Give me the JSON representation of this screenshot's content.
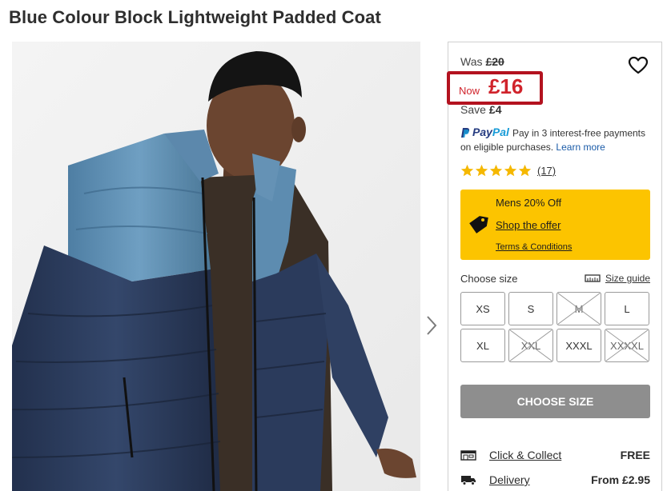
{
  "product": {
    "title": "Blue Colour Block Lightweight Padded Coat",
    "image_description": "model wearing blue colour block padded coat"
  },
  "pricing": {
    "was_label": "Was",
    "was_price": "£20",
    "now_label": "Now",
    "now_price": "£16",
    "save_label": "Save",
    "save_amount": "£4"
  },
  "paypal": {
    "pay": "Pay",
    "pal": "Pal",
    "message": "Pay in 3 interest-free payments on eligible purchases.",
    "link": "Learn more"
  },
  "rating": {
    "stars": 5,
    "review_count": "(17)"
  },
  "offer": {
    "title": "Mens 20% Off",
    "link": "Shop the offer",
    "terms": "Terms & Conditions",
    "color": "#fcc400"
  },
  "size": {
    "label": "Choose size",
    "guide": "Size guide",
    "options": [
      {
        "label": "XS",
        "available": true
      },
      {
        "label": "S",
        "available": true
      },
      {
        "label": "M",
        "available": false
      },
      {
        "label": "L",
        "available": true
      },
      {
        "label": "XL",
        "available": true
      },
      {
        "label": "XXL",
        "available": false
      },
      {
        "label": "XXXL",
        "available": true
      },
      {
        "label": "XXXXL",
        "available": false
      }
    ]
  },
  "cta": {
    "label": "CHOOSE SIZE"
  },
  "delivery": {
    "click_collect": {
      "label": "Click & Collect",
      "price": "FREE",
      "icon": "store-icon"
    },
    "home": {
      "label": "Delivery",
      "price": "From £2.95",
      "icon": "truck-icon"
    }
  },
  "colors": {
    "price_red": "#d0232b",
    "highlight_border": "#b3121f",
    "button_grey": "#8e8e8e"
  }
}
